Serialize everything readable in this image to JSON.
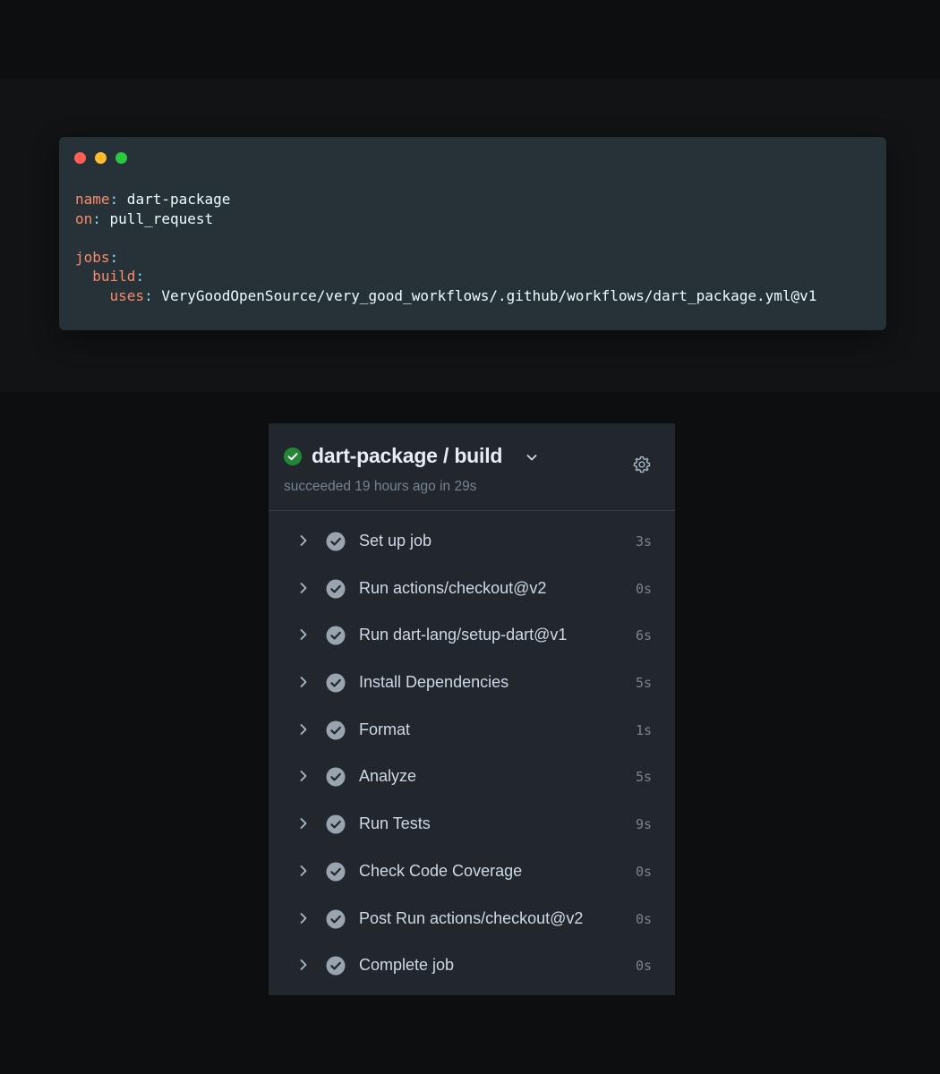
{
  "code_window": {
    "lines": [
      {
        "key": "name",
        "sep": ":",
        "value": " dart-package",
        "indent": ""
      },
      {
        "key": "on",
        "sep": ":",
        "value": " pull_request",
        "indent": ""
      },
      {
        "key": "",
        "sep": "",
        "value": "",
        "indent": ""
      },
      {
        "key": "jobs",
        "sep": ":",
        "value": "",
        "indent": ""
      },
      {
        "key": "build",
        "sep": ":",
        "value": "",
        "indent": "  "
      },
      {
        "key": "uses",
        "sep": ":",
        "value": " VeryGoodOpenSource/very_good_workflows/.github/workflows/dart_package.yml@v1",
        "indent": "    "
      }
    ],
    "colors": {
      "key": "#f78c6c",
      "punct": "#89ddff",
      "value": "#eeffff",
      "background": "#263238"
    }
  },
  "job": {
    "title": "dart-package / build",
    "subtitle": "succeeded 19 hours ago in 29s",
    "status_icon": "check-circle-icon",
    "status_color": "#238636",
    "steps": [
      {
        "name": "Set up job",
        "duration": "3s"
      },
      {
        "name": "Run actions/checkout@v2",
        "duration": "0s"
      },
      {
        "name": "Run dart-lang/setup-dart@v1",
        "duration": "6s"
      },
      {
        "name": "Install Dependencies",
        "duration": "5s"
      },
      {
        "name": "Format",
        "duration": "1s"
      },
      {
        "name": "Analyze",
        "duration": "5s"
      },
      {
        "name": "Run Tests",
        "duration": "9s"
      },
      {
        "name": "Check Code Coverage",
        "duration": "0s"
      },
      {
        "name": "Post Run actions/checkout@v2",
        "duration": "0s"
      },
      {
        "name": "Complete job",
        "duration": "0s"
      }
    ]
  }
}
